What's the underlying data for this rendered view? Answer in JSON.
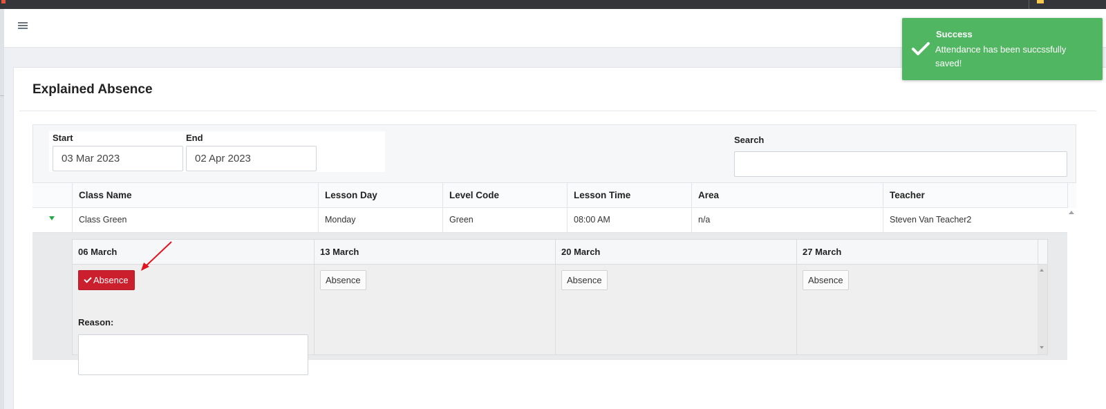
{
  "page": {
    "title": "Explained Absence"
  },
  "filters": {
    "start_label": "Start",
    "start_value": "03 Mar 2023",
    "end_label": "End",
    "end_value": "02 Apr 2023",
    "search_label": "Search",
    "search_value": ""
  },
  "table": {
    "columns": [
      "Class Name",
      "Lesson Day",
      "Level Code",
      "Lesson Time",
      "Area",
      "Teacher"
    ],
    "rows": [
      {
        "class_name": "Class Green",
        "lesson_day": "Monday",
        "level_code": "Green",
        "lesson_time": "08:00 AM",
        "area": "n/a",
        "teacher": "Steven Van Teacher2"
      }
    ]
  },
  "detail": {
    "dates": [
      "06 March",
      "13 March",
      "20 March",
      "27 March"
    ],
    "absence_label": "Absence",
    "reason_label": "Reason:",
    "reason_value": "",
    "marked_absent": [
      true,
      false,
      false,
      false
    ]
  },
  "toast": {
    "title": "Success",
    "message": "Attendance has been succssfully saved!",
    "color": "#51b661"
  },
  "colors": {
    "absence_active": "#cc1f2e",
    "expand_toggle": "#28a745",
    "annotation_arrow": "#e0141e"
  },
  "icons": {
    "menu": "hamburger-icon",
    "expand": "triangle-down-icon",
    "check": "check-icon"
  }
}
